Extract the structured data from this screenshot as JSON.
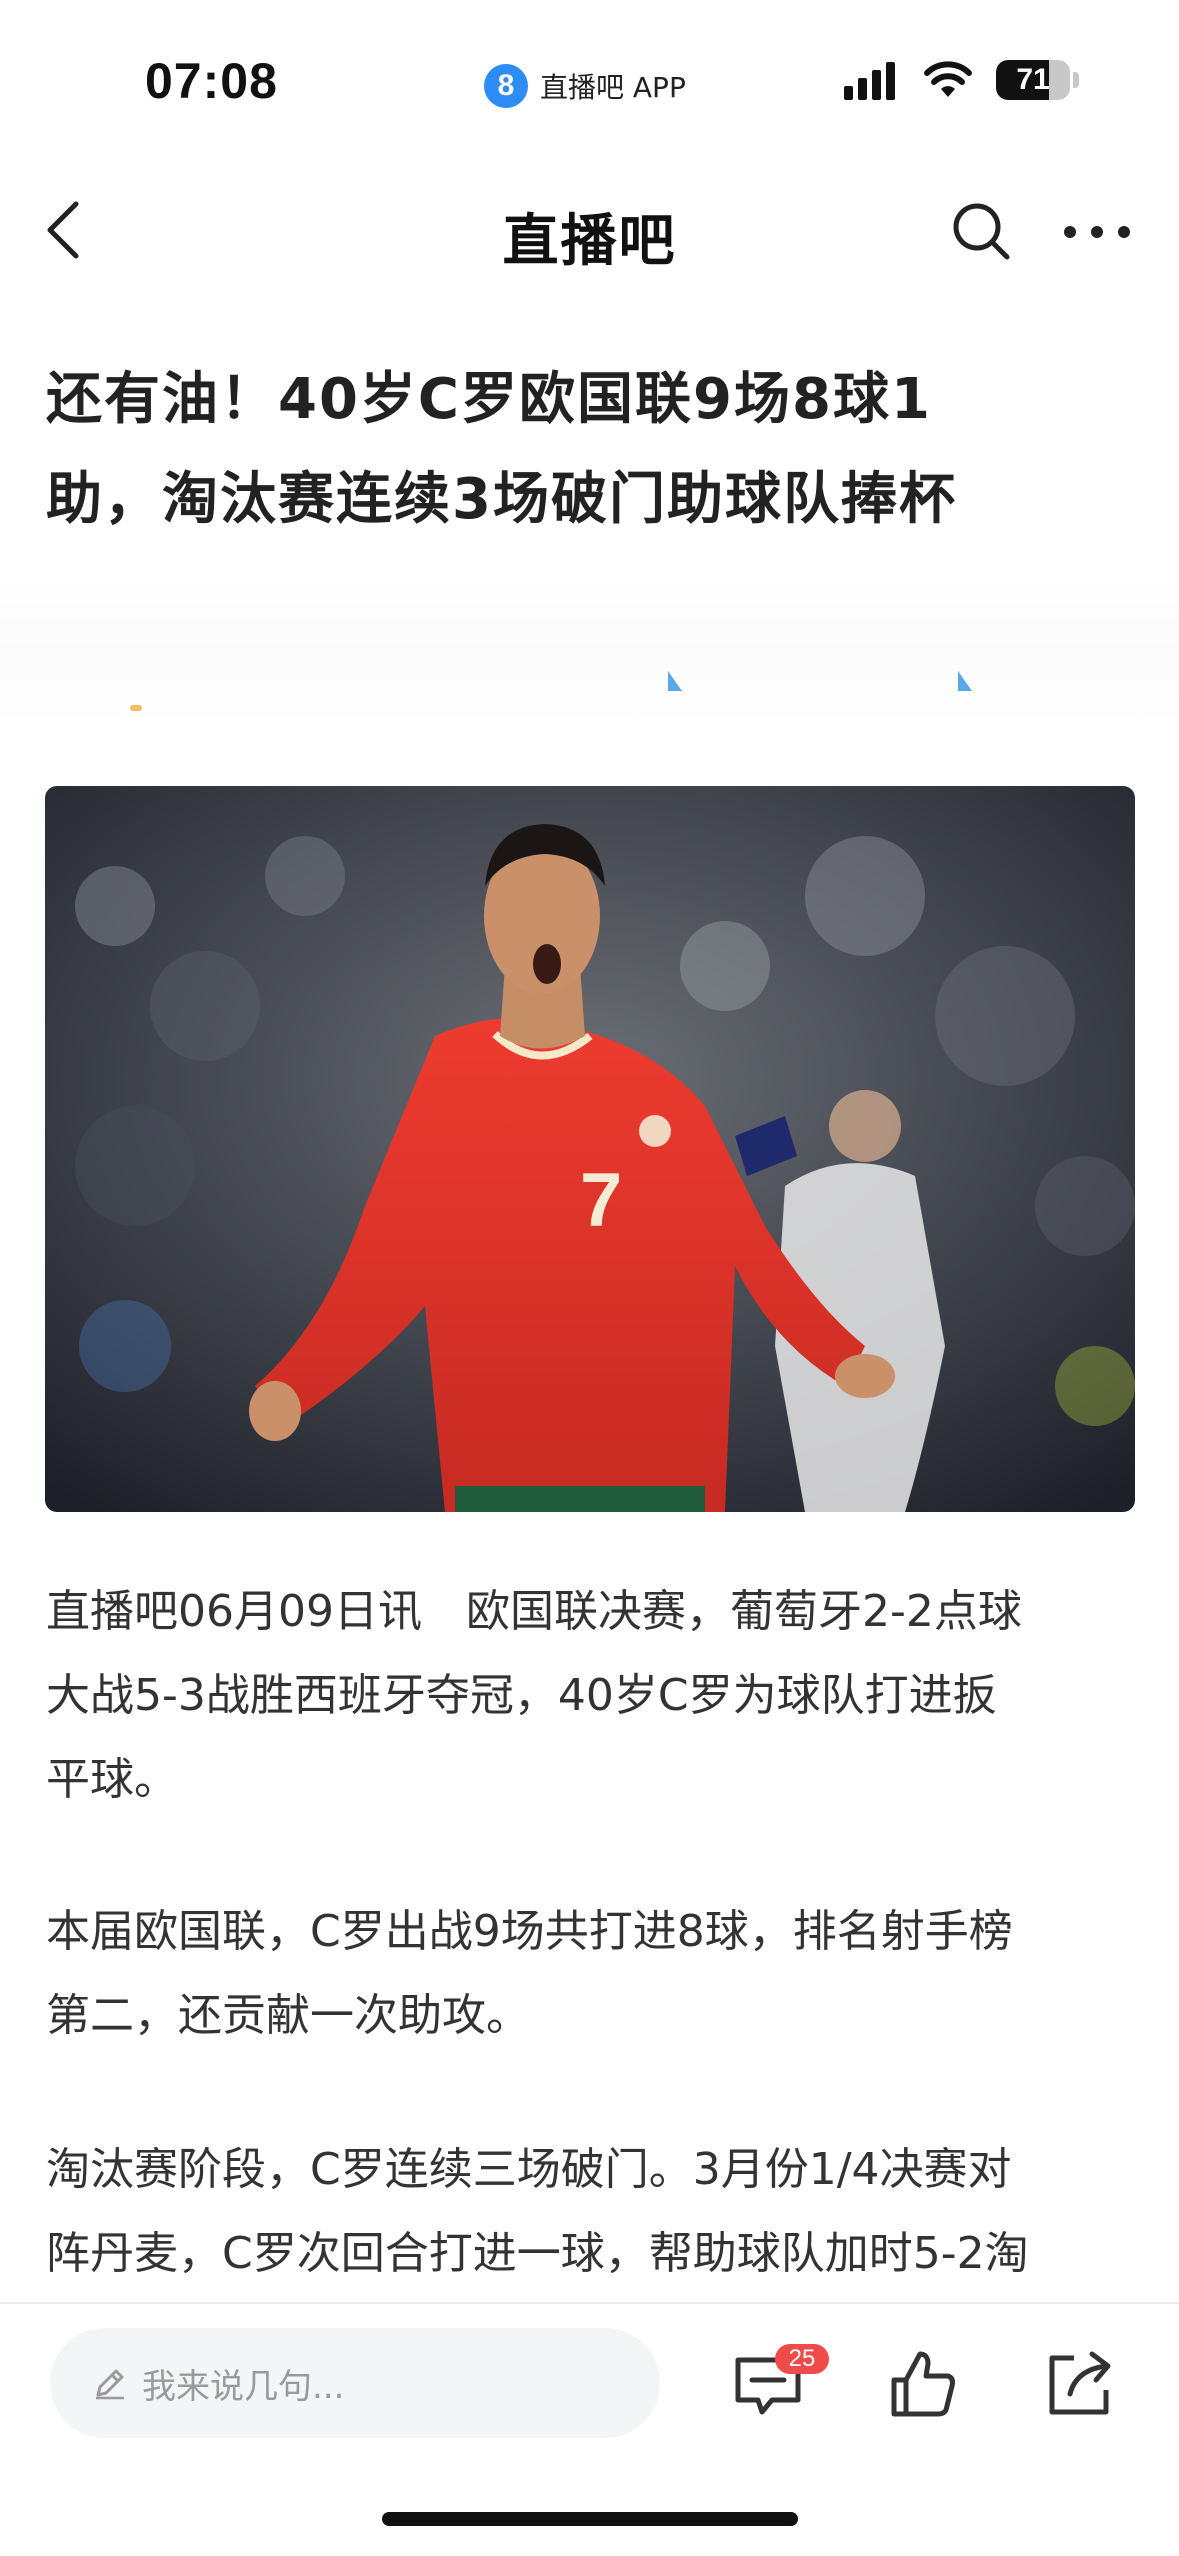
{
  "status_bar": {
    "time": "07:08",
    "app_badge": "8",
    "app_name": "直播吧 APP",
    "battery": "71",
    "battery_level": 0.71,
    "icons": [
      "signal-icon",
      "wifi-icon",
      "battery-icon"
    ]
  },
  "nav": {
    "title": "直播吧",
    "icons": [
      "back-chevron-icon",
      "search-icon",
      "more-icon"
    ]
  },
  "article": {
    "title_lines": [
      "还有油！40岁C罗欧国联9场8球1",
      "助，淘汰赛连续3场破门助球队捧杯"
    ],
    "image_alt_number": "7",
    "paragraphs": [
      [
        "直播吧06月09日讯　欧国联决赛，葡萄牙2-2点球",
        "大战5-3战胜西班牙夺冠，40岁C罗为球队打进扳",
        "平球。"
      ],
      [
        "本届欧国联，C罗出战9场共打进8球，排名射手榜",
        "第二，还贡献一次助攻。"
      ],
      [
        "淘汰赛阶段，C罗连续三场破门。3月份1/4决赛对",
        "阵丹麦，C罗次回合打进一球，帮助球队加时5-2淘"
      ]
    ]
  },
  "bottom_bar": {
    "comment_placeholder": "我来说几句...",
    "comment_count": "25",
    "icons": [
      "pencil-icon",
      "comment-icon",
      "like-icon",
      "share-icon"
    ]
  },
  "colors": {
    "accent_blue": "#2e8cf5",
    "badge_red": "#f04b4b",
    "jersey_red": "#e0312a"
  }
}
